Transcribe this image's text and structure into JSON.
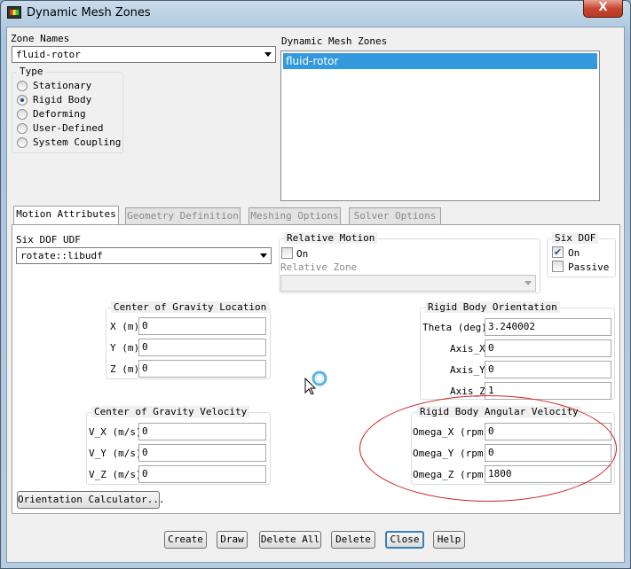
{
  "window": {
    "title": "Dynamic Mesh Zones",
    "close_glyph": "X"
  },
  "zone_names": {
    "label": "Zone Names",
    "selected": "fluid-rotor"
  },
  "type": {
    "title": "Type",
    "options": [
      "Stationary",
      "Rigid Body",
      "Deforming",
      "User-Defined",
      "System Coupling"
    ],
    "selected": "Rigid Body"
  },
  "dmz_list": {
    "label": "Dynamic Mesh Zones",
    "items": [
      "fluid-rotor"
    ]
  },
  "tabs": [
    "Motion Attributes",
    "Geometry Definition",
    "Meshing Options",
    "Solver Options"
  ],
  "active_tab": "Motion Attributes",
  "six_dof_udf": {
    "label": "Six DOF UDF",
    "selected": "rotate::libudf"
  },
  "relative_motion": {
    "title": "Relative Motion",
    "on_label": "On",
    "on_checked": false,
    "zone_label": "Relative Zone",
    "zone_value": ""
  },
  "six_dof": {
    "title": "Six DOF",
    "on_label": "On",
    "on_checked": true,
    "passive_label": "Passive",
    "passive_checked": false
  },
  "cog_location": {
    "title": "Center of Gravity Location",
    "labels": [
      "X (m)",
      "Y (m)",
      "Z (m)"
    ],
    "values": [
      "0",
      "0",
      "0"
    ]
  },
  "rb_orientation": {
    "title": "Rigid Body Orientation",
    "labels": [
      "Theta (deg)",
      "Axis_X",
      "Axis_Y",
      "Axis_Z"
    ],
    "values": [
      "3.240002",
      "0",
      "0",
      "1"
    ]
  },
  "cog_velocity": {
    "title": "Center of Gravity Velocity",
    "labels": [
      "V_X (m/s)",
      "V_Y (m/s)",
      "V_Z (m/s)"
    ],
    "values": [
      "0",
      "0",
      "0"
    ]
  },
  "rb_angular_velocity": {
    "title": "Rigid Body Angular Velocity",
    "labels": [
      "Omega_X (rpm)",
      "Omega_Y (rpm)",
      "Omega_Z (rpm)"
    ],
    "values": [
      "0",
      "0",
      "1800"
    ]
  },
  "orientation_calculator": "Orientation Calculator...",
  "buttons": {
    "create": "Create",
    "draw": "Draw",
    "delete_all": "Delete All",
    "delete": "Delete",
    "close": "Close",
    "help": "Help"
  },
  "colors": {
    "selection": "#3399dd",
    "annotation": "#d02020",
    "focus": "#3c7fb1"
  }
}
